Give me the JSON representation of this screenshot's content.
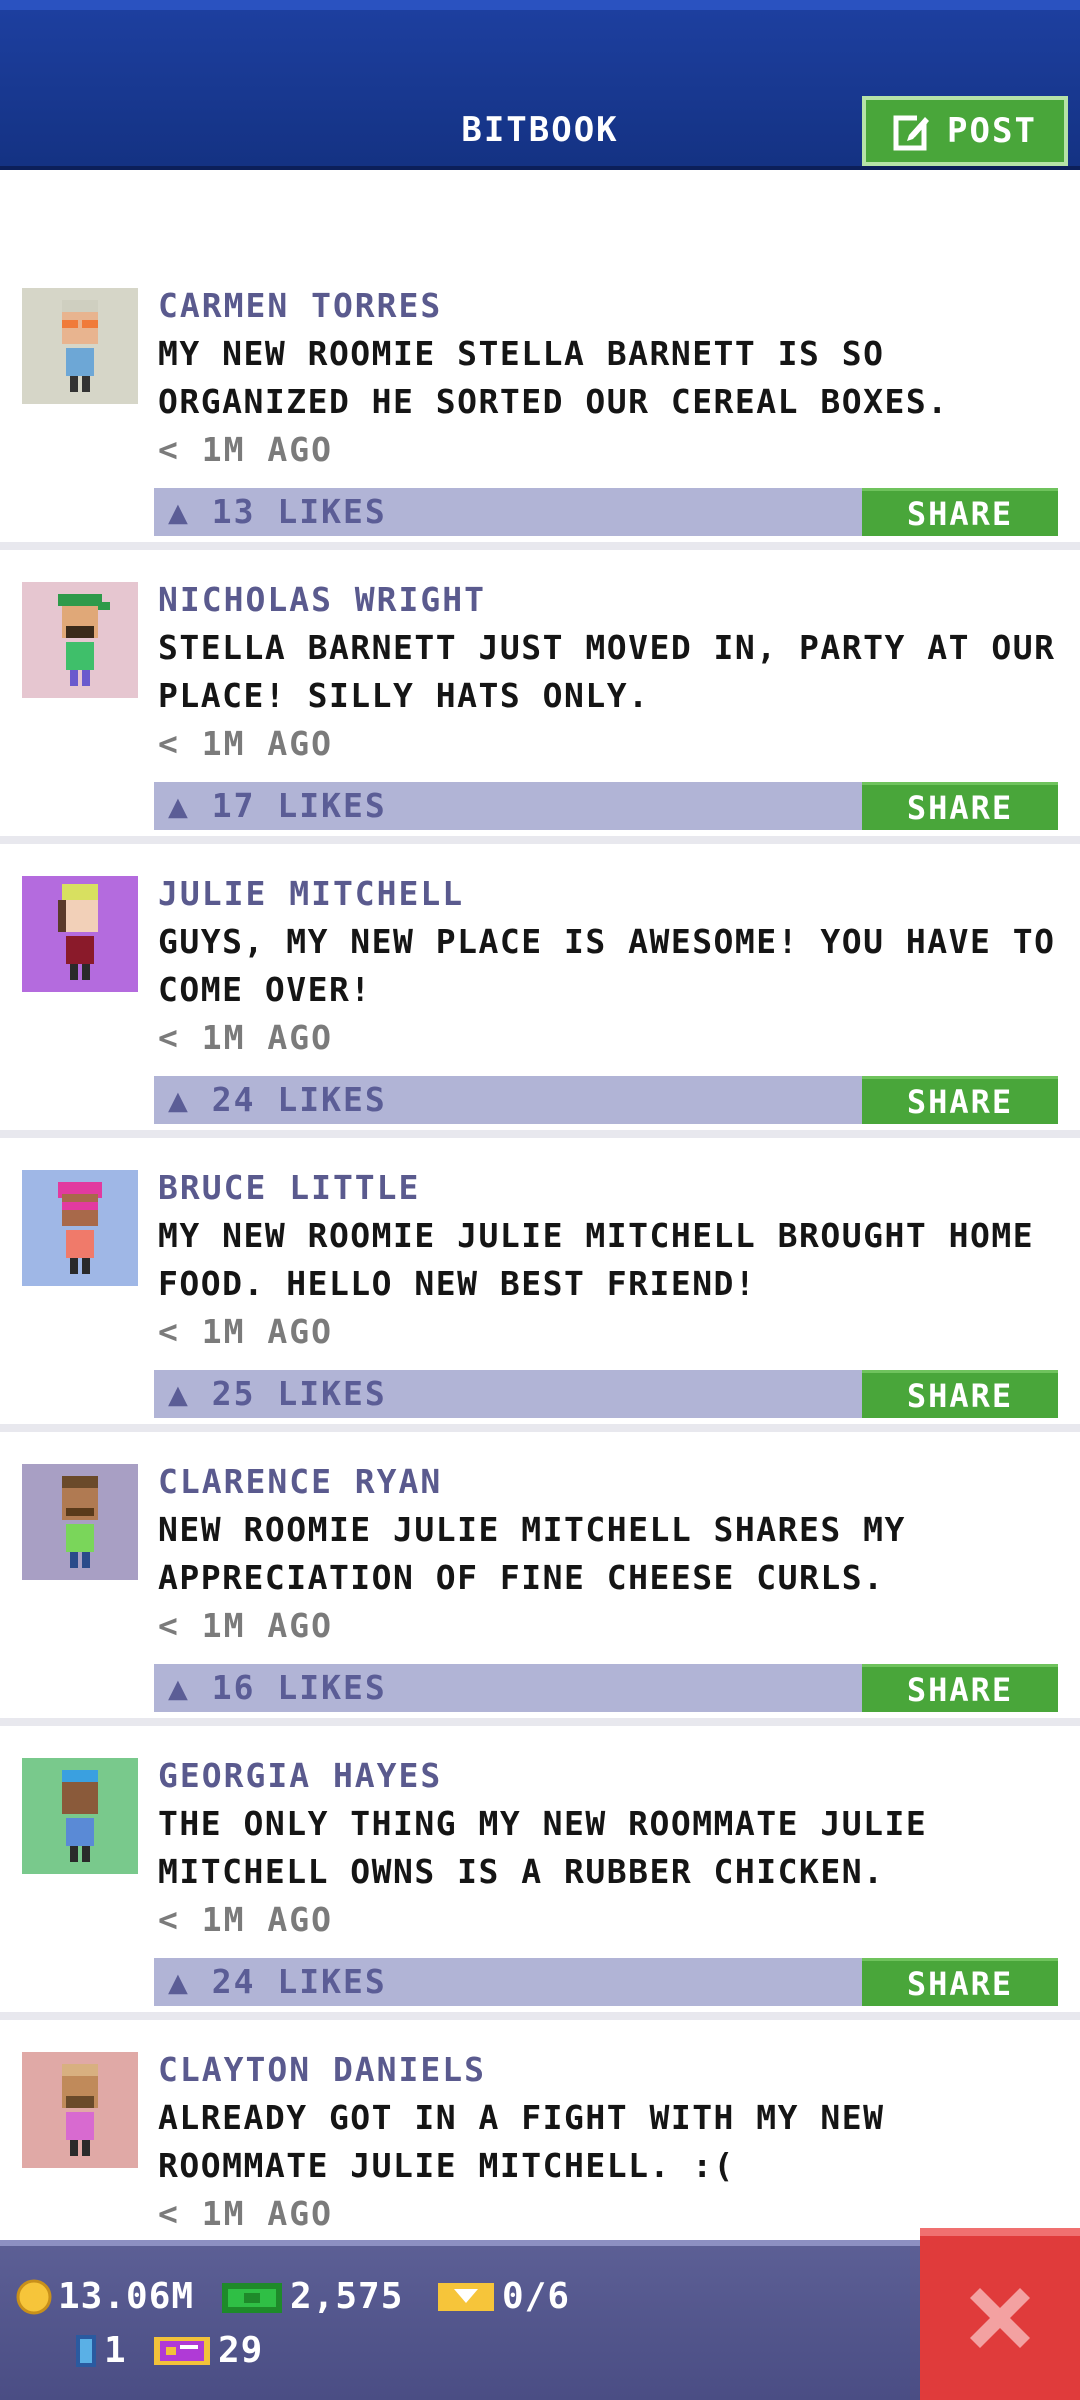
{
  "header": {
    "title": "BITBOOK",
    "post_label": "POST"
  },
  "posts": [
    {
      "name": "CARMEN TORRES",
      "text": "MY NEW ROOMIE STELLA BARNETT IS SO ORGANIZED HE SORTED OUR CEREAL BOXES.",
      "time": "1M AGO",
      "likes": "13 LIKES",
      "share": "SHARE",
      "avatar_bg": "#d6d6c8"
    },
    {
      "name": "NICHOLAS WRIGHT",
      "text": "STELLA BARNETT JUST MOVED IN, PARTY AT OUR PLACE! SILLY HATS ONLY.",
      "time": "1M AGO",
      "likes": "17 LIKES",
      "share": "SHARE",
      "avatar_bg": "#e6c6d0"
    },
    {
      "name": "JULIE MITCHELL",
      "text": "GUYS, MY NEW PLACE IS AWESOME! YOU HAVE TO COME OVER!",
      "time": "1M AGO",
      "likes": "24 LIKES",
      "share": "SHARE",
      "avatar_bg": "#b46bde"
    },
    {
      "name": "BRUCE LITTLE",
      "text": "MY NEW ROOMIE JULIE MITCHELL BROUGHT HOME FOOD. HELLO NEW BEST FRIEND!",
      "time": "1M AGO",
      "likes": "25 LIKES",
      "share": "SHARE",
      "avatar_bg": "#9fb7e6"
    },
    {
      "name": "CLARENCE RYAN",
      "text": "NEW ROOMIE JULIE MITCHELL SHARES MY APPRECIATION OF FINE CHEESE CURLS.",
      "time": "1M AGO",
      "likes": "16 LIKES",
      "share": "SHARE",
      "avatar_bg": "#a89fc4"
    },
    {
      "name": "GEORGIA HAYES",
      "text": "THE ONLY THING MY NEW ROOMMATE JULIE MITCHELL OWNS IS A RUBBER CHICKEN.",
      "time": "1M AGO",
      "likes": "24 LIKES",
      "share": "SHARE",
      "avatar_bg": "#79c98c"
    },
    {
      "name": "CLAYTON DANIELS",
      "text": "ALREADY GOT IN A FIGHT WITH MY NEW ROOMMATE JULIE MITCHELL. :(",
      "time": "1M AGO",
      "likes": "",
      "share": "",
      "avatar_bg": "#e0a9a6"
    }
  ],
  "footer": {
    "coins": "13.06M",
    "bux": "2,575",
    "tickets": "0/6",
    "level": "1",
    "vip": "29"
  },
  "colors": {
    "header_blue": "#1d3f9f",
    "share_green": "#49a63a",
    "likes_bar": "#b1b4d6",
    "footer_purple": "#5c5f95",
    "close_red": "#e03b3b"
  }
}
